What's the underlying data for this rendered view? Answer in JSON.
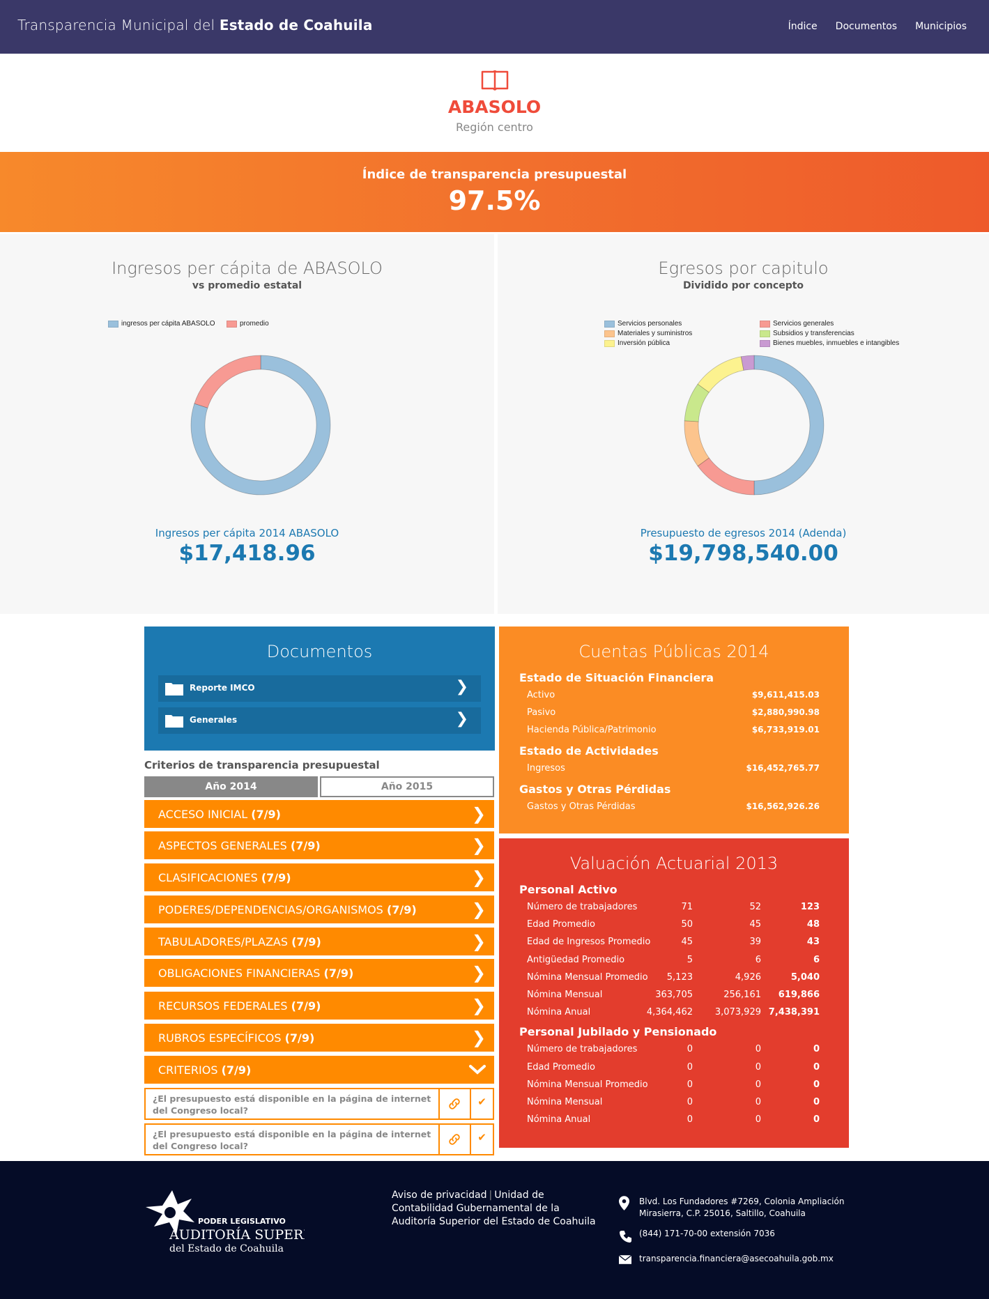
{
  "header": {
    "brand_light": "Transparencia Municipal del ",
    "brand_bold": "Estado de Coahuila",
    "nav": [
      "Índice",
      "Documentos",
      "Municipios"
    ]
  },
  "hero": {
    "icon": "book-icon",
    "municipality": "ABASOLO",
    "region": "Región centro"
  },
  "index_band": {
    "title": "Índice de transparencia presupuestal",
    "value": "97.5%"
  },
  "ingresos": {
    "title": "Ingresos per cápita de ABASOLO",
    "subtitle": "vs promedio estatal",
    "caption": "Ingresos per cápita 2014 ABASOLO",
    "value": "$17,418.96"
  },
  "egresos": {
    "title": "Egresos por capitulo",
    "subtitle": "Dividido por concepto",
    "caption": "Presupuesto de egresos 2014 (Adenda)",
    "value": "$19,798,540.00"
  },
  "chart_data": [
    {
      "type": "pie",
      "series": [
        {
          "name": "ingresos per cápita ABASOLO",
          "value": 80,
          "color": "#9ac0dc"
        },
        {
          "name": "promedio",
          "value": 20,
          "color": "#f79a93"
        }
      ]
    },
    {
      "type": "pie",
      "series": [
        {
          "name": "Servicios personales",
          "value": 50,
          "color": "#9ac0dc"
        },
        {
          "name": "Servicios generales",
          "value": 15,
          "color": "#f79a93"
        },
        {
          "name": "Materiales y suministros",
          "value": 11,
          "color": "#fcc48d"
        },
        {
          "name": "Subsidios y transferencias",
          "value": 9,
          "color": "#c9e88c"
        },
        {
          "name": "Inversión pública",
          "value": 12,
          "color": "#fcf28f"
        },
        {
          "name": "Bienes muebles, inmuebles e intangibles",
          "value": 3,
          "color": "#c99ad2"
        }
      ]
    }
  ],
  "documentos": {
    "title": "Documentos",
    "items": [
      "Reporte IMCO",
      "Generales"
    ]
  },
  "criterios": {
    "title": "Criterios de transparencia presupuestal",
    "years": [
      "Año 2014",
      "Año 2015"
    ],
    "items": [
      {
        "label": "ACCESO INICIAL",
        "count": "(7/9)"
      },
      {
        "label": "ASPECTOS GENERALES",
        "count": "(7/9)"
      },
      {
        "label": "CLASIFICACIONES",
        "count": "(7/9)"
      },
      {
        "label": "PODERES/DEPENDENCIAS/ORGANISMOS",
        "count": "(7/9)"
      },
      {
        "label": "TABULADORES/PLAZAS",
        "count": "(7/9)"
      },
      {
        "label": "OBLIGACIONES FINANCIERAS",
        "count": "(7/9)"
      },
      {
        "label": "RECURSOS FEDERALES",
        "count": "(7/9)"
      },
      {
        "label": "RUBROS ESPECÍFICOS",
        "count": "(7/9)"
      },
      {
        "label": "CRITERIOS",
        "count": "(7/9)"
      }
    ],
    "questions": [
      "¿El presupuesto está disponible en la página de internet del Congreso local?",
      "¿El presupuesto está disponible en la página de internet del Congreso local?"
    ],
    "check": "✔"
  },
  "cuentas": {
    "title": "Cuentas Públicas 2014",
    "sections": [
      {
        "title": "Estado de Situación Financiera",
        "rows": [
          {
            "k": "Activo",
            "v": "$9,611,415.03"
          },
          {
            "k": "Pasivo",
            "v": "$2,880,990.98"
          },
          {
            "k": "Hacienda Pública/Patrimonio",
            "v": "$6,733,919.01"
          }
        ]
      },
      {
        "title": "Estado de Actividades",
        "rows": [
          {
            "k": "Ingresos",
            "v": "$16,452,765.77"
          }
        ]
      },
      {
        "title": "Gastos y Otras Pérdidas",
        "rows": [
          {
            "k": "Gastos y Otras Pérdidas",
            "v": "$16,562,926.26"
          }
        ]
      }
    ]
  },
  "valuacion": {
    "title": "Valuación Actuarial 2013",
    "sections": [
      {
        "title": "Personal Activo",
        "rows": [
          {
            "k": "Número de trabajadores",
            "a": "71",
            "b": "52",
            "t": "123"
          },
          {
            "k": "Edad Promedio",
            "a": "50",
            "b": "45",
            "t": "48"
          },
          {
            "k": "Edad de Ingresos Promedio",
            "a": "45",
            "b": "39",
            "t": "43"
          },
          {
            "k": "Antigüedad Promedio",
            "a": "5",
            "b": "6",
            "t": "6"
          },
          {
            "k": "Nómina Mensual Promedio",
            "a": "5,123",
            "b": "4,926",
            "t": "5,040"
          },
          {
            "k": "Nómina Mensual",
            "a": "363,705",
            "b": "256,161",
            "t": "619,866"
          },
          {
            "k": "Nómina Anual",
            "a": "4,364,462",
            "b": "3,073,929",
            "t": "7,438,391"
          }
        ]
      },
      {
        "title": "Personal Jubilado y Pensionado",
        "rows": [
          {
            "k": "Número de trabajadores",
            "a": "0",
            "b": "0",
            "t": "0"
          },
          {
            "k": "Edad Promedio",
            "a": "0",
            "b": "0",
            "t": "0"
          },
          {
            "k": "Nómina Mensual Promedio",
            "a": "0",
            "b": "0",
            "t": "0"
          },
          {
            "k": "Nómina Mensual",
            "a": "0",
            "b": "0",
            "t": "0"
          },
          {
            "k": "Nómina Anual",
            "a": "0",
            "b": "0",
            "t": "0"
          }
        ]
      }
    ]
  },
  "footer": {
    "logo_line1": "PODER LEGISLATIVO",
    "logo_line2": "AUDITORÍA SUPERIOR",
    "logo_line3": "del Estado de Coahuila",
    "privacy": "Aviso de privacidad",
    "unit": "Unidad de Contabilidad Gubernamental de la Auditoría Superior del Estado de Coahuila",
    "address": "Blvd. Los Fundadores #7269, Colonia Ampliación Mirasierra, C.P. 25016, Saltillo, Coahuila",
    "phone": "(844) 171-70-00 extensión 7036",
    "email": "transparencia.financiera@asecoahuila.gob.mx"
  }
}
